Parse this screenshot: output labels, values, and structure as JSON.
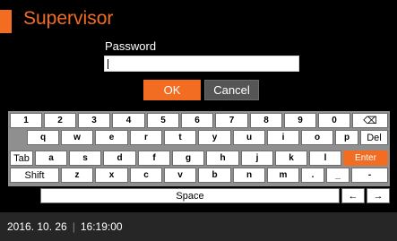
{
  "header": {
    "title": "Supervisor"
  },
  "password": {
    "label": "Password",
    "value": ""
  },
  "actions": {
    "ok_label": "OK",
    "cancel_label": "Cancel"
  },
  "keyboard": {
    "rows": [
      [
        "1",
        "2",
        "3",
        "4",
        "5",
        "6",
        "7",
        "8",
        "9",
        "0",
        "⌫"
      ],
      [
        "q",
        "w",
        "e",
        "r",
        "t",
        "y",
        "u",
        "i",
        "o",
        "p",
        "Del"
      ],
      [
        "Tab",
        "a",
        "s",
        "d",
        "f",
        "g",
        "h",
        "j",
        "k",
        "l",
        "Enter"
      ],
      [
        "Shift",
        "z",
        "x",
        "c",
        "v",
        "b",
        "n",
        "m",
        ".",
        "_",
        "-"
      ],
      [
        "Space",
        "←",
        "→"
      ]
    ]
  },
  "status": {
    "date": "2016. 10. 26",
    "separator": "|",
    "time": "16:19:00"
  },
  "colors": {
    "accent": "#f26d21",
    "background": "#000000",
    "keyboard_bg": "#8f8f8f"
  }
}
